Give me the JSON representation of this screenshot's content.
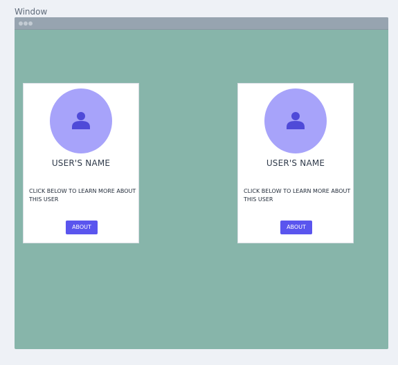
{
  "window": {
    "label": "Window"
  },
  "colors": {
    "page_background": "#eef1f6",
    "canvas_background": "#87b5aa",
    "titlebar": "#97a4b0",
    "card_background": "#ffffff",
    "avatar_background": "#a7a3fa",
    "accent": "#5a55ee"
  },
  "cards": [
    {
      "avatar_icon": "user-icon",
      "name": "USER'S NAME",
      "description": "CLICK BELOW TO LEARN MORE ABOUT THIS USER",
      "button_label": "ABOUT"
    },
    {
      "avatar_icon": "user-icon",
      "name": "USER'S NAME",
      "description": "CLICK BELOW TO LEARN MORE ABOUT THIS USER",
      "button_label": "ABOUT"
    }
  ]
}
